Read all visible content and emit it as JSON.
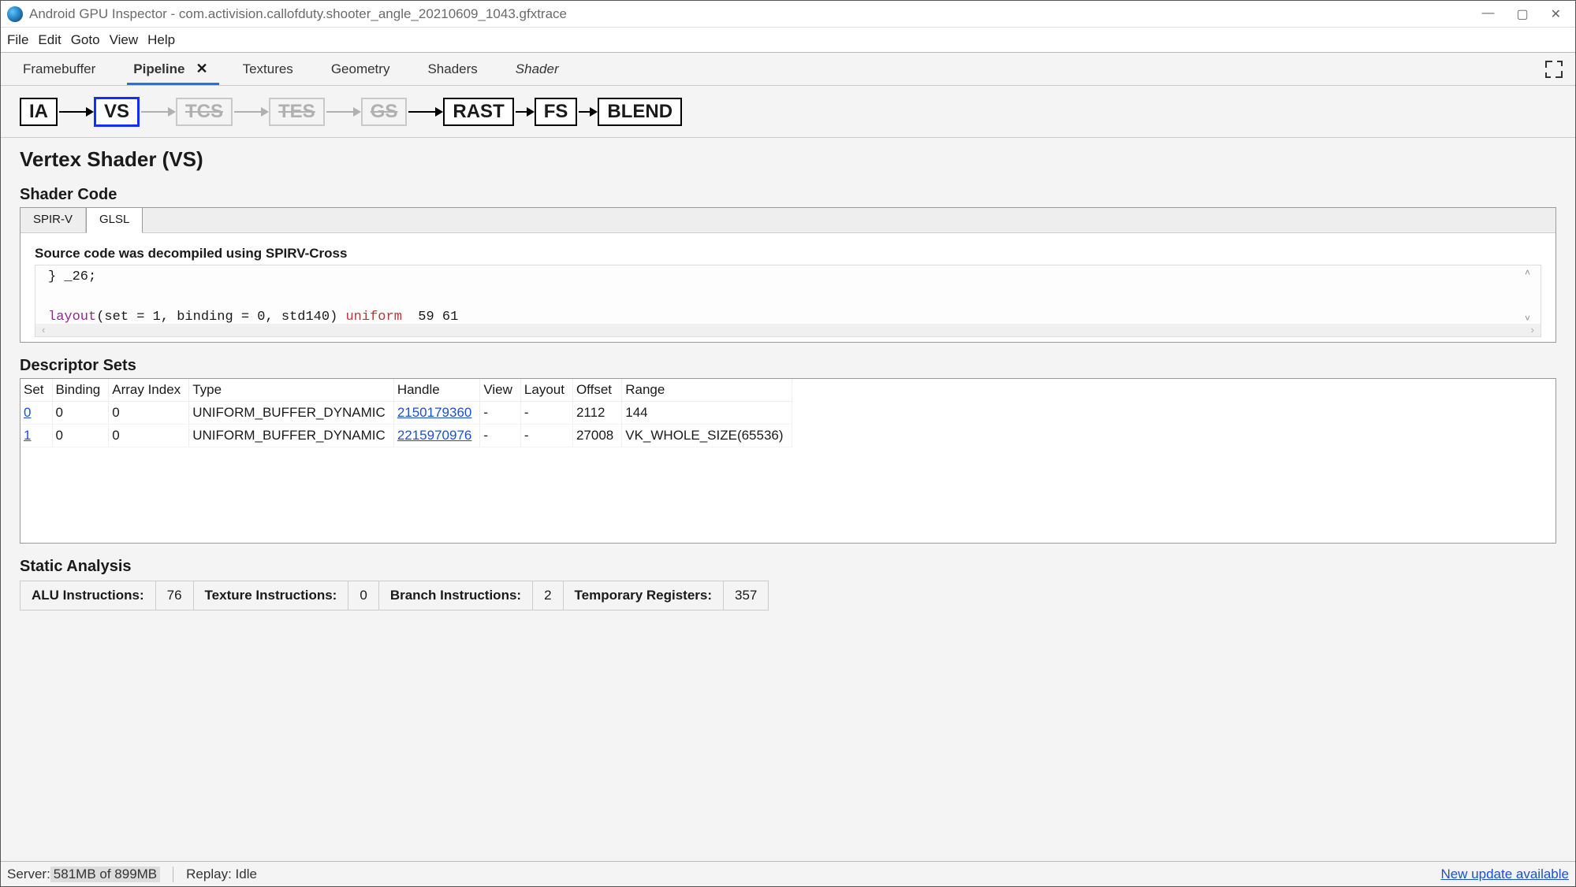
{
  "window": {
    "title": "Android GPU Inspector - com.activision.callofduty.shooter_angle_20210609_1043.gfxtrace"
  },
  "menu": {
    "file": "File",
    "edit": "Edit",
    "goto": "Goto",
    "view": "View",
    "help": "Help"
  },
  "toolbar_tabs": {
    "framebuffer": "Framebuffer",
    "pipeline": "Pipeline",
    "textures": "Textures",
    "geometry": "Geometry",
    "shaders": "Shaders",
    "shader": "Shader"
  },
  "pipeline_stages": {
    "ia": "IA",
    "vs": "VS",
    "tcs": "TCS",
    "tes": "TES",
    "gs": "GS",
    "rast": "RAST",
    "fs": "FS",
    "blend": "BLEND"
  },
  "headings": {
    "page_title": "Vertex Shader (VS)",
    "shader_code": "Shader Code",
    "descriptor_sets": "Descriptor Sets",
    "static_analysis": "Static Analysis"
  },
  "code_tabs": {
    "spirv": "SPIR-V",
    "glsl": "GLSL"
  },
  "code_note": "Source code was decompiled using SPIRV-Cross",
  "code_lines": {
    "l1": "} _26;",
    "l2_a": "layout",
    "l2_b": "(set = 1, binding = 0, std140) ",
    "l2_c": "uniform",
    "l2_d": "  59 61"
  },
  "desc_headers": {
    "set": "Set",
    "binding": "Binding",
    "array_index": "Array Index",
    "type": "Type",
    "handle": "Handle",
    "view": "View",
    "layout": "Layout",
    "offset": "Offset",
    "range": "Range"
  },
  "desc_rows": [
    {
      "set": "0",
      "binding": "0",
      "array_index": "0",
      "type": "UNIFORM_BUFFER_DYNAMIC",
      "handle": "2150179360",
      "view": "-",
      "layout": "-",
      "offset": "2112",
      "range": "144"
    },
    {
      "set": "1",
      "binding": "0",
      "array_index": "0",
      "type": "UNIFORM_BUFFER_DYNAMIC",
      "handle": "2215970976",
      "view": "-",
      "layout": "-",
      "offset": "27008",
      "range": "VK_WHOLE_SIZE(65536)"
    }
  ],
  "static": {
    "alu_label": "ALU Instructions:",
    "alu_value": "76",
    "tex_label": "Texture Instructions:",
    "tex_value": "0",
    "branch_label": "Branch Instructions:",
    "branch_value": "2",
    "temp_label": "Temporary Registers:",
    "temp_value": "357"
  },
  "status": {
    "server_prefix": "Server: ",
    "server_mem": "581MB of 899MB",
    "replay": "Replay: Idle",
    "update": "New update available"
  }
}
